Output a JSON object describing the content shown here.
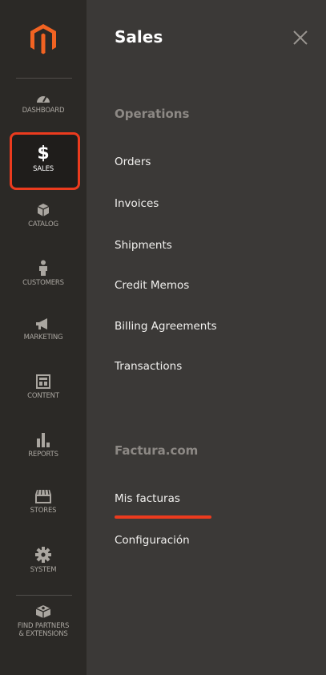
{
  "sidebar": {
    "items": [
      {
        "label": "DASHBOARD",
        "icon": "dashboard-gauge-icon"
      },
      {
        "label": "SALES",
        "icon": "dollar-sign-icon",
        "glyph": "$",
        "active": true
      },
      {
        "label": "CATALOG",
        "icon": "box-icon"
      },
      {
        "label": "CUSTOMERS",
        "icon": "person-icon"
      },
      {
        "label": "MARKETING",
        "icon": "megaphone-icon"
      },
      {
        "label": "CONTENT",
        "icon": "layout-icon"
      },
      {
        "label": "REPORTS",
        "icon": "bar-chart-icon"
      },
      {
        "label": "STORES",
        "icon": "storefront-icon"
      },
      {
        "label": "SYSTEM",
        "icon": "gear-icon"
      },
      {
        "label": "FIND PARTNERS & EXTENSIONS",
        "line1": "FIND PARTNERS",
        "line2": "& EXTENSIONS",
        "icon": "extension-box-icon"
      }
    ]
  },
  "panel": {
    "title": "Sales",
    "groups": [
      {
        "title": "Operations",
        "items": [
          "Orders",
          "Invoices",
          "Shipments",
          "Credit Memos",
          "Billing Agreements",
          "Transactions"
        ]
      },
      {
        "title": "Factura.com",
        "items": [
          "Mis facturas",
          "Configuración"
        ]
      }
    ]
  },
  "colors": {
    "accent": "#eb3b1e",
    "sidebar_bg": "#2b2926",
    "panel_bg": "#3b3937"
  }
}
